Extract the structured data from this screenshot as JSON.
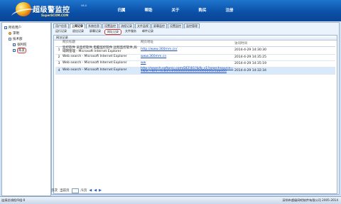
{
  "app": {
    "brand": "超级警监控",
    "version": "V6.0",
    "subtitle": "SuperSCOM.COM"
  },
  "topnav": [
    "归属",
    "帮助",
    "关于",
    "购买",
    "注册"
  ],
  "tree": [
    {
      "label": "所有用户"
    },
    {
      "label": "李明"
    },
    {
      "label": "技术部"
    },
    {
      "label": "张利旺"
    },
    {
      "label": "陈友"
    }
  ],
  "tabs_primary": [
    "用户信息",
    "上网记录",
    "系统信息",
    "设置监控",
    "流程记录",
    "文件监视",
    "屏幕监控",
    "设置监控",
    "监控管理"
  ],
  "tabs_secondary": [
    "运行记录",
    "退出记录",
    "屏幕记录",
    "网址记录",
    "文件服务",
    "邮件记录"
  ],
  "panel_title": "网址记录",
  "table": {
    "headers": [
      "网页标题",
      "网页地址",
      "访问时间"
    ],
    "rows": [
      {
        "idx": "1",
        "title": "监控软件 员监控软件,电脑监控软件,远程监控软件,局域网管理 - Microsoft Internet Explorer",
        "url": "http://www.360mm.cn/",
        "time": "2014-4-29 14:30:30"
      },
      {
        "idx": "2",
        "title": "Web search - Microsoft Internet Explorer",
        "url": "www.360mm.cn",
        "time": "2014-4-29 14:35:25"
      },
      {
        "idx": "3",
        "title": "Web search - Microsoft Internet Explorer",
        "url": "ww",
        "time": "2014-4-29 14:35:19"
      },
      {
        "idx": "4",
        "title": "Web search - Microsoft Internet Explorer",
        "url": "http://search.softonic.com/DEFI01?&fb_c1?searchsource=1&ac=&fd=4c84fcdf0000000000000000000a1bbd00",
        "time": "2014-4-29 14:32:34"
      }
    ]
  },
  "bottom": {
    "page_label": "页次",
    "count_label": "当前页",
    "pages_label": "/1页"
  },
  "status": {
    "left": "连接总线程/0组:0",
    "right": "深圳市超级网吧软件有限公司 2005-2014"
  },
  "colors": {
    "header": "#0b4fa6",
    "accent": "#d23a3a",
    "link": "#2050c0"
  }
}
